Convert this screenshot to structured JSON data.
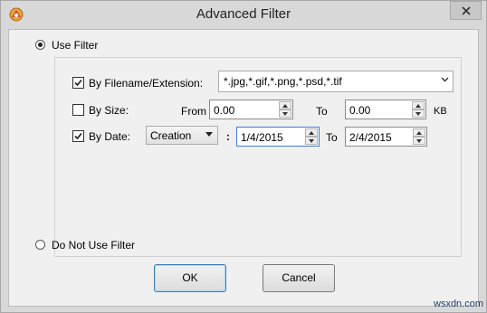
{
  "window": {
    "title": "Advanced Filter",
    "app_icon": "app-logo-icon",
    "close_icon": "close-icon"
  },
  "options": {
    "use_filter_label": "Use Filter",
    "use_filter_selected": true,
    "do_not_use_filter_label": "Do Not Use Filter"
  },
  "filename_filter": {
    "label": "By Filename/Extension:",
    "checked": true,
    "value": "*.jpg,*.gif,*.png,*.psd,*.tif"
  },
  "size_filter": {
    "label": "By Size:",
    "checked": false,
    "from_label": "From",
    "from_value": "0.00",
    "to_label": "To",
    "to_value": "0.00",
    "unit": "KB"
  },
  "date_filter": {
    "label": "By Date:",
    "checked": true,
    "type": "Creation",
    "separator": ":",
    "from_value": "1/4/2015",
    "to_label": "To",
    "to_value": "2/4/2015"
  },
  "buttons": {
    "ok": "OK",
    "cancel": "Cancel"
  },
  "watermark": "wsxdn.com"
}
